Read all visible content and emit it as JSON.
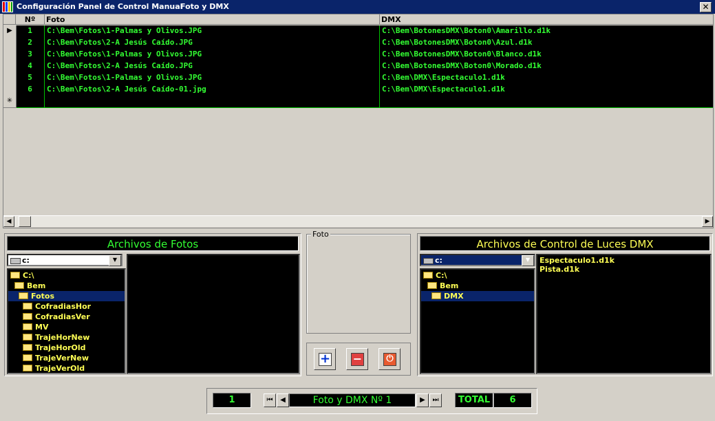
{
  "window": {
    "title": "Configuración Panel de Control Manual",
    "subtitle": "Foto y DMX",
    "close_label": "✕"
  },
  "grid": {
    "headers": {
      "num": "Nº",
      "foto": "Foto",
      "dmx": "DMX"
    },
    "rows": [
      {
        "num": "1",
        "foto": "C:\\Bem\\Fotos\\1-Palmas y Olivos.JPG",
        "dmx": "C:\\Bem\\BotonesDMX\\Boton0\\Amarillo.d1k"
      },
      {
        "num": "2",
        "foto": "C:\\Bem\\Fotos\\2-A Jesús Caído.JPG",
        "dmx": "C:\\Bem\\BotonesDMX\\Boton0\\Azul.d1k"
      },
      {
        "num": "3",
        "foto": "C:\\Bem\\Fotos\\1-Palmas y Olivos.JPG",
        "dmx": "C:\\Bem\\BotonesDMX\\Boton0\\Blanco.d1k"
      },
      {
        "num": "4",
        "foto": "C:\\Bem\\Fotos\\2-A Jesús Caído.JPG",
        "dmx": "C:\\Bem\\BotonesDMX\\Boton0\\Morado.d1k"
      },
      {
        "num": "5",
        "foto": "C:\\Bem\\Fotos\\1-Palmas y Olivos.JPG",
        "dmx": "C:\\Bem\\DMX\\Espectaculo1.d1k"
      },
      {
        "num": "6",
        "foto": "C:\\Bem\\Fotos\\2-A Jesús Caído-01.jpg",
        "dmx": "C:\\Bem\\DMX\\Espectaculo1.d1k"
      }
    ],
    "current_marker": "▶",
    "new_row_marker": "✳"
  },
  "fotos_panel": {
    "title": "Archivos de Fotos",
    "drive": "c:",
    "tree": [
      "C:\\",
      "Bem",
      "Fotos",
      "CofradiasHor",
      "CofradiasVer",
      "MV",
      "TrajeHorNew",
      "TrajeHorOld",
      "TrajeVerNew",
      "TrajeVerOld"
    ],
    "selected": "Fotos"
  },
  "foto_preview": {
    "label": "Foto"
  },
  "dmx_panel": {
    "title": "Archivos de Control de Luces DMX",
    "drive": "c:",
    "tree": [
      "C:\\",
      "Bem",
      "DMX"
    ],
    "selected": "DMX",
    "files": [
      "Espectaculo1.d1k",
      "Pista.d1k"
    ]
  },
  "actions": {
    "add": "+",
    "remove": "−",
    "exit": "⏻"
  },
  "navigation": {
    "record_number": "1",
    "caption": "Foto y DMX Nº 1",
    "total_label": "TOTAL",
    "total_value": "6"
  },
  "colors": {
    "grid_text": "#33ff33",
    "tree_text": "#ffff55",
    "titlebar": "#0a246a",
    "face": "#d4d0c8"
  }
}
